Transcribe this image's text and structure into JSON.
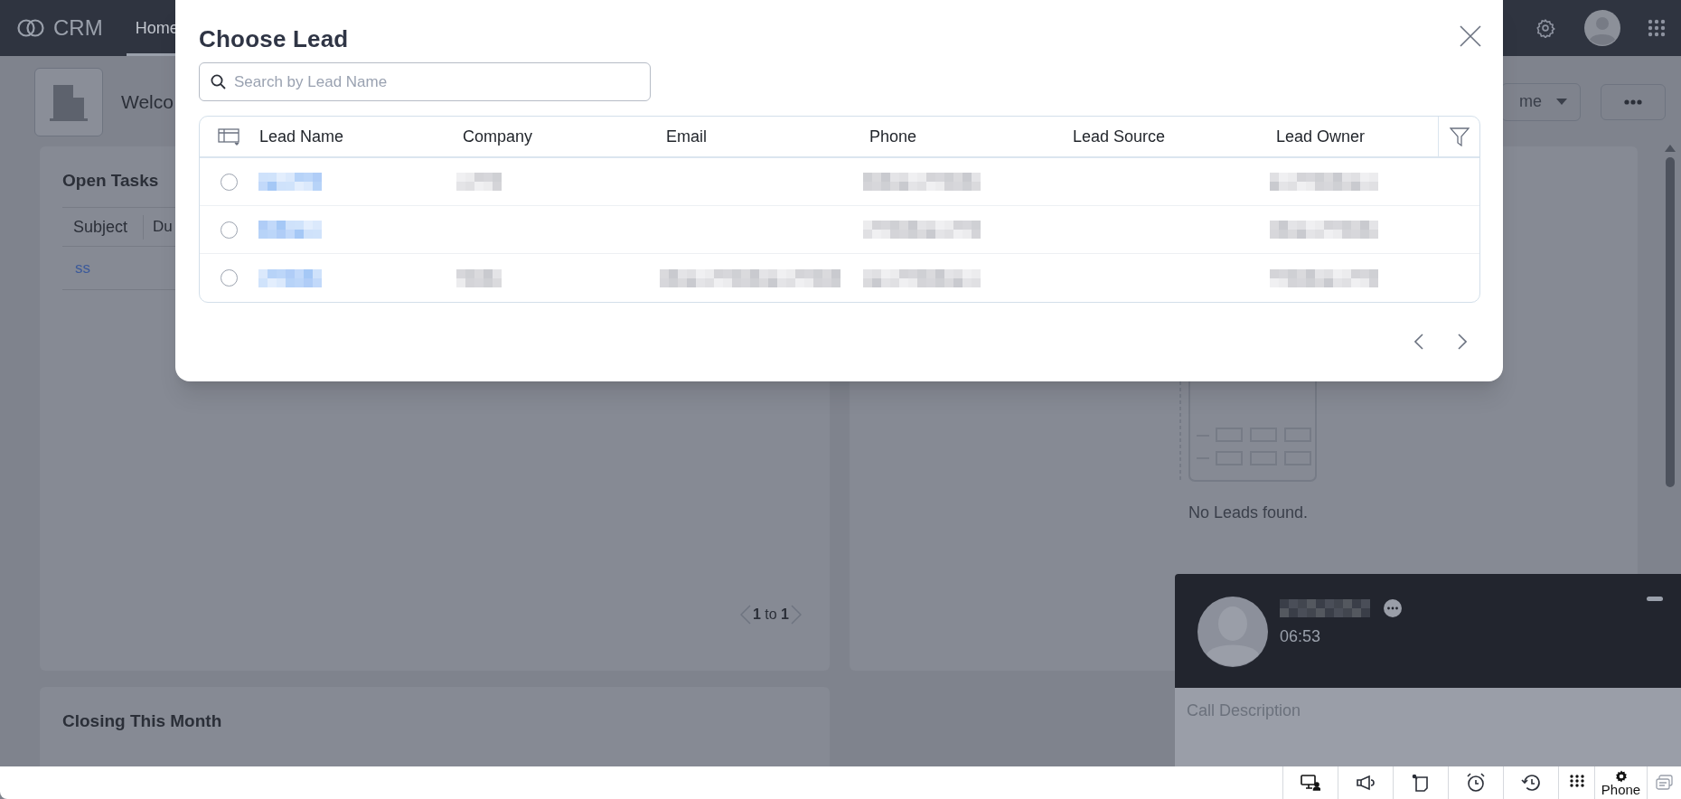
{
  "app": {
    "logo": "CRM",
    "tabs": [
      {
        "label": "Home",
        "selected": true
      }
    ]
  },
  "page": {
    "welcome": "Welco",
    "view_button": "me"
  },
  "open_tasks": {
    "title": "Open Tasks",
    "columns": [
      "Subject",
      "Du"
    ],
    "rows": [
      {
        "subject": "ss"
      }
    ],
    "pagination": "**1** to **1**"
  },
  "leads_card": {
    "empty": "No Leads found."
  },
  "closing": {
    "title": "Closing This Month"
  },
  "dialog": {
    "title": "Choose Lead",
    "search": {
      "placeholder": "Search by Lead Name"
    },
    "columns": [
      "Lead Name",
      "Company",
      "Email",
      "Phone",
      "Lead Source",
      "Lead Owner"
    ],
    "rows": [
      {
        "selected": false,
        "redacted": [
          true,
          true,
          false,
          true,
          false,
          true
        ]
      },
      {
        "selected": false,
        "redacted": [
          true,
          false,
          false,
          true,
          false,
          true
        ]
      },
      {
        "selected": false,
        "redacted": [
          true,
          true,
          true,
          true,
          false,
          true
        ]
      }
    ]
  },
  "call": {
    "caller_redacted": true,
    "timer": "06:53",
    "description": {
      "placeholder": "Call Description"
    }
  },
  "bottom_bar": {
    "phone_label": "Phone"
  }
}
